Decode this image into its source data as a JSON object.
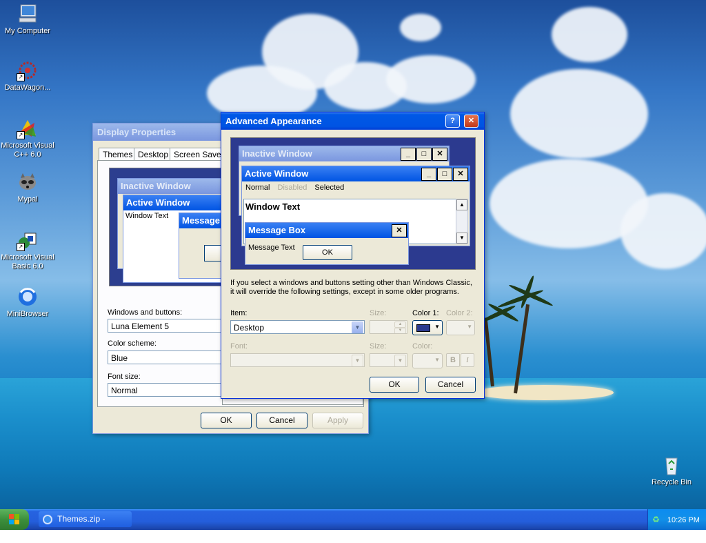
{
  "desktop": {
    "icons": [
      {
        "label": "My Computer"
      },
      {
        "label": "DataWagon..."
      },
      {
        "label": "Microsoft Visual C++ 6.0"
      },
      {
        "label": "Mypal"
      },
      {
        "label": "Microsoft Visual Basic 6.0"
      },
      {
        "label": "MiniBrowser"
      },
      {
        "label": "Recycle Bin"
      }
    ]
  },
  "display_properties": {
    "title": "Display Properties",
    "tabs": [
      "Themes",
      "Desktop",
      "Screen Saver"
    ],
    "preview": {
      "inactive_title": "Inactive Window",
      "active_title": "Active Window",
      "window_text": "Window Text",
      "message_title": "Message"
    },
    "windows_buttons_label": "Windows and buttons:",
    "windows_buttons_value": "Luna Element 5",
    "color_scheme_label": "Color scheme:",
    "color_scheme_value": "Blue",
    "font_size_label": "Font size:",
    "font_size_value": "Normal",
    "ok": "OK",
    "cancel": "Cancel",
    "apply": "Apply"
  },
  "advanced_appearance": {
    "title": "Advanced Appearance",
    "help_btn": "?",
    "close_btn": "✕",
    "preview": {
      "inactive_title": "Inactive Window",
      "active_title": "Active Window",
      "menu_normal": "Normal",
      "menu_disabled": "Disabled",
      "menu_selected": "Selected",
      "window_text": "Window Text",
      "msgbox_title": "Message Box",
      "msg_text": "Message Text",
      "msg_ok": "OK"
    },
    "note": "If you select a windows and buttons setting other than Windows Classic, it will override the following settings, except in some older programs.",
    "item_label": "Item:",
    "item_value": "Desktop",
    "size_label": "Size:",
    "color1_label": "Color 1:",
    "color2_label": "Color 2:",
    "color1_value": "#2b3a8f",
    "font_label": "Font:",
    "font_size_label": "Size:",
    "font_color_label": "Color:",
    "bold": "B",
    "italic": "I",
    "ok": "OK",
    "cancel": "Cancel"
  },
  "taskbar": {
    "task_label": "Themes.zip - Chromium",
    "clock": "10:26 PM"
  }
}
